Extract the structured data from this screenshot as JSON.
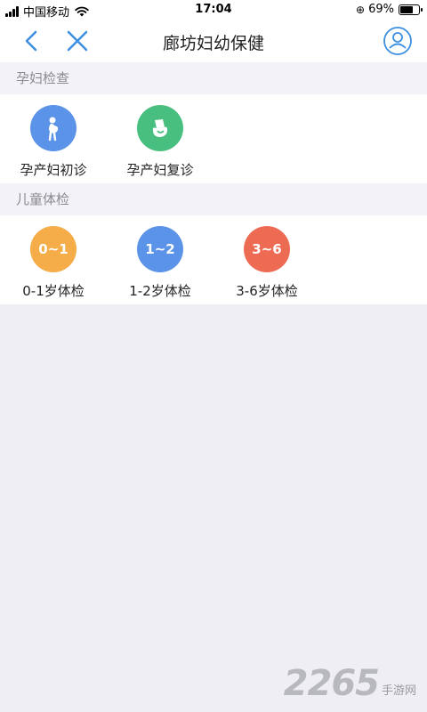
{
  "status_bar": {
    "carrier": "中国移动",
    "time": "17:04",
    "battery": "69%",
    "battery_level": 0.69
  },
  "nav": {
    "title": "廊坊妇幼保健"
  },
  "sections": [
    {
      "header": "孕妇检查",
      "items": [
        {
          "label": "孕产妇初诊",
          "icon": "pregnant-woman-icon",
          "color": "#5b93e8"
        },
        {
          "label": "孕产妇复诊",
          "icon": "pregnant-checkup-icon",
          "color": "#48bf7f"
        }
      ]
    },
    {
      "header": "儿童体检",
      "items": [
        {
          "label": "0-1岁体检",
          "badge": "0~1",
          "color": "#f4ad48"
        },
        {
          "label": "1-2岁体检",
          "badge": "1~2",
          "color": "#5a93e8"
        },
        {
          "label": "3-6岁体检",
          "badge": "3~6",
          "color": "#ee6b53"
        }
      ]
    }
  ],
  "watermark": {
    "number": "2265",
    "text": "手游网"
  }
}
